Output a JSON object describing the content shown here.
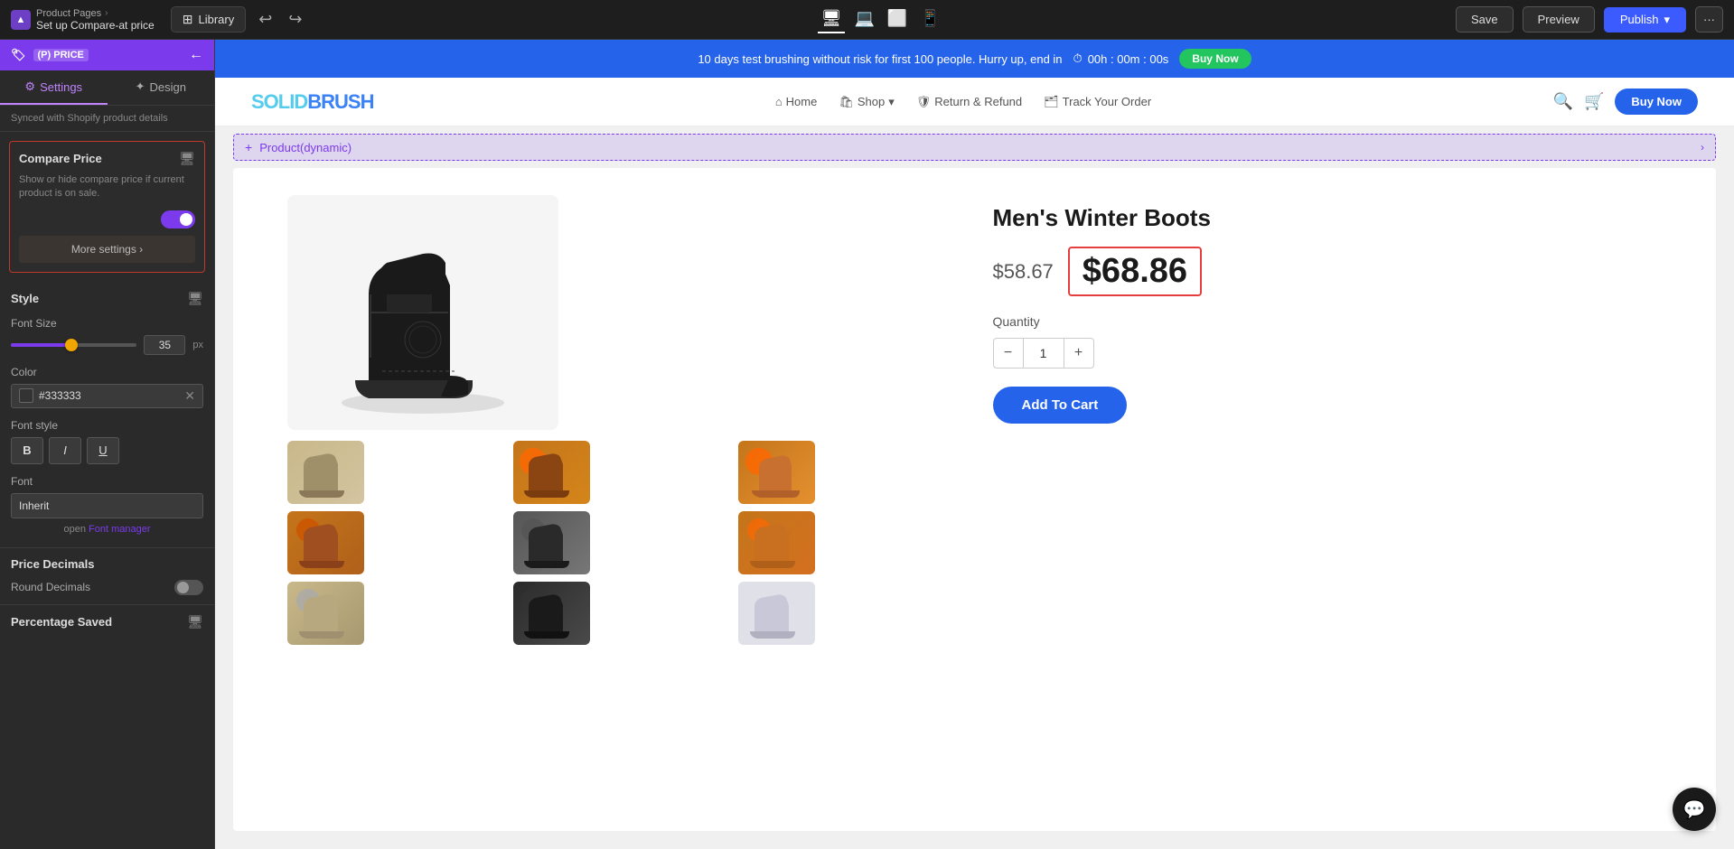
{
  "topBar": {
    "breadcrumb": "Product Pages",
    "subtitle": "Set up Compare-at price",
    "libraryBtn": "Library",
    "saveBtn": "Save",
    "previewBtn": "Preview",
    "publishBtn": "Publish",
    "moreBtn": "···"
  },
  "sidebar": {
    "header": {
      "badge": "(P) PRICE",
      "backArrow": "←"
    },
    "tabs": {
      "settings": "Settings",
      "design": "Design"
    },
    "syncedNotice": "Synced with Shopify product details",
    "comparePrice": {
      "title": "Compare Price",
      "description": "Show or hide compare price if current product is on sale.",
      "toggleState": "on",
      "moreSettings": "More settings ›"
    },
    "style": {
      "title": "Style",
      "fontSize": {
        "label": "Font Size",
        "value": "35",
        "unit": "px"
      },
      "color": {
        "label": "Color",
        "value": "#333333"
      },
      "fontStyle": {
        "label": "Font style",
        "bold": "B",
        "italic": "I",
        "underline": "U"
      },
      "font": {
        "label": "Font",
        "value": "Inherit",
        "managerText": "open",
        "managerLink": "Font manager"
      }
    },
    "priceDecimals": {
      "title": "Price Decimals",
      "roundDecimals": "Round Decimals"
    },
    "percentageSaved": {
      "title": "Percentage Saved"
    }
  },
  "announcement": {
    "text": "10 days test brushing without risk for first 100 people. Hurry up, end in",
    "timer": "00h : 00m : 00s",
    "buyNow": "Buy Now"
  },
  "storeNav": {
    "logo1": "SOLID",
    "logo2": "BRUSH",
    "links": [
      "Home",
      "Shop",
      "Return & Refund",
      "Track Your Order"
    ],
    "buyNow": "Buy Now"
  },
  "productBanner": {
    "label": "Product(dynamic)",
    "plus": "+"
  },
  "product": {
    "title": "Men's Winter Boots",
    "comparePrice": "$58.67",
    "mainPrice": "$68.86",
    "quantity": {
      "label": "Quantity",
      "value": "1",
      "minus": "−",
      "plus": "+"
    },
    "addToCart": "Add To Cart",
    "thumbnails": [
      {
        "color": "thumb-1"
      },
      {
        "color": "thumb-2"
      },
      {
        "color": "thumb-3"
      },
      {
        "color": "thumb-4"
      },
      {
        "color": "thumb-5"
      },
      {
        "color": "thumb-6"
      },
      {
        "color": "thumb-7"
      },
      {
        "color": "thumb-8"
      },
      {
        "color": "thumb-9"
      }
    ]
  }
}
